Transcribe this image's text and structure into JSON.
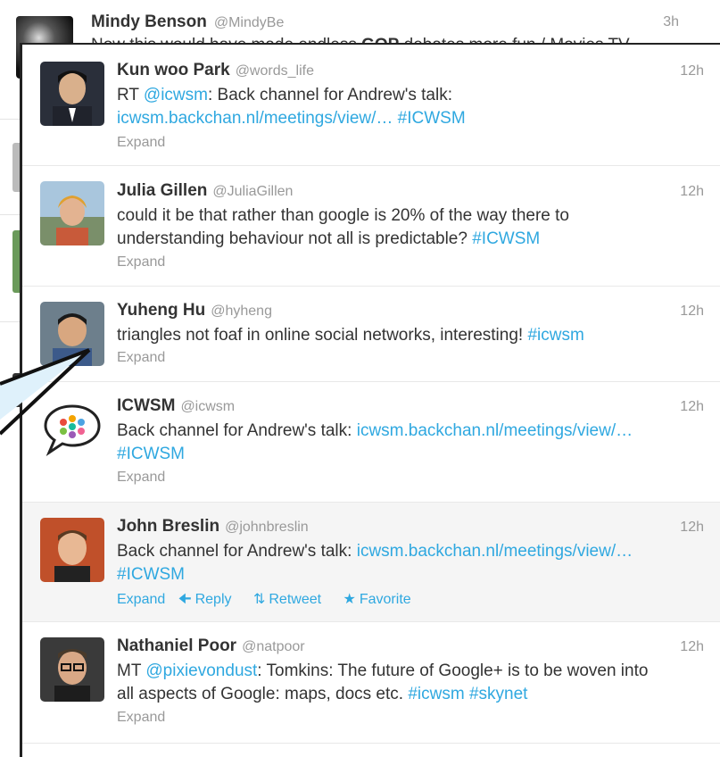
{
  "background_tweet": {
    "name": "Mindy Benson",
    "handle": "@MindyBe",
    "time": "3h",
    "text_pre": "Now this would have made endless ",
    "text_bold": "GOP",
    "text_post": " debates more fun / Movies TV"
  },
  "tweets": [
    {
      "name": "Kun woo Park",
      "handle": "@words_life",
      "time": "12h",
      "text1": "RT ",
      "mention": "@icwsm",
      "text2": ": Back channel for Andrew's talk:",
      "link": "icwsm.backchan.nl/meetings/view/…",
      "hashtag": "#ICWSM",
      "expand": "Expand"
    },
    {
      "name": "Julia Gillen",
      "handle": "@JuliaGillen",
      "time": "12h",
      "text1": "could it be that rather than google is 20% of the way there to",
      "text2": "understanding behaviour not all is predictable?",
      "hashtag": "#ICWSM",
      "expand": "Expand"
    },
    {
      "name": "Yuheng Hu",
      "handle": "@hyheng",
      "time": "12h",
      "text1": "triangles not foaf in online social networks, interesting!",
      "hashtag": "#icwsm",
      "expand": "Expand"
    },
    {
      "name": "ICWSM",
      "handle": "@icwsm",
      "time": "12h",
      "text1": "Back channel for Andrew's talk:",
      "link": "icwsm.backchan.nl/meetings/view/…",
      "hashtag": "#ICWSM",
      "expand": "Expand"
    },
    {
      "name": "John Breslin",
      "handle": "@johnbreslin",
      "time": "12h",
      "text1": "Back channel for Andrew's talk:",
      "link": "icwsm.backchan.nl/meetings/view/…",
      "hashtag": "#ICWSM",
      "expand": "Expand",
      "reply": "Reply",
      "retweet": "Retweet",
      "favorite": "Favorite"
    },
    {
      "name": "Nathaniel Poor",
      "handle": "@natpoor",
      "time": "12h",
      "text1": "MT ",
      "mention": "@pixievondust",
      "text2": ": Tomkins: The future of Google+ is to be woven into",
      "text3": "all aspects of Google: maps, docs etc.",
      "hashtag": "#icwsm",
      "hashtag2": "#skynet",
      "expand": "Expand"
    }
  ],
  "colors": {
    "link": "#2fa8e0",
    "muted": "#999999",
    "text": "#333333",
    "highlight_row": "#f5f5f5"
  }
}
